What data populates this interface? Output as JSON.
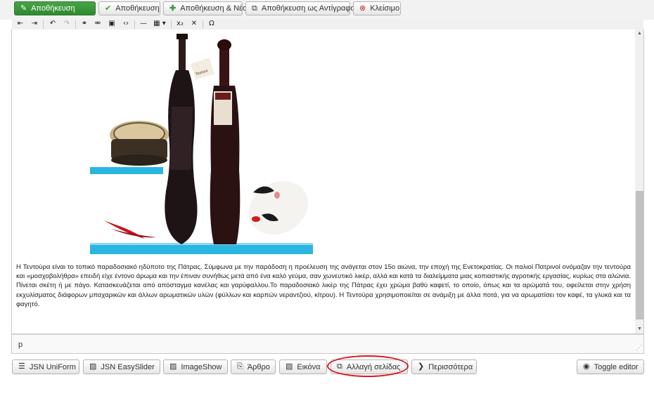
{
  "toolbar": {
    "save": "Αποθήκευση",
    "save_close": "Αποθήκευση",
    "save_new": "Αποθήκευση & Νέο",
    "save_copy": "Αποθήκευση ως Αντίγραφο",
    "close": "Κλείσιμο"
  },
  "editor": {
    "paragraph": "Η Τεντούρα είναι το τοπικό παραδοσιακό ηδύποτο της Πάτρας. Σύμφωνα με την παράδοση η προέλευση της ανάγεται στον 15ο αιώνα, την εποχή της Ενετοκρατίας. Οι παλιοί Πατρινοί ονόμαζαν την τεντούρα και «μοσχοβολήθρα» επειδή είχε έντονο άρωμα και την έπιναν συνήθως μετά από ένα καλό γεύμα, σαν χωνευτικό λικέρ, αλλά και κατά τα διαλείμματα μιας κοπιαστικής αγροτικής εργασίας, κυρίως στα αλώνια. Πίνεται σκέτη ή με πάγο. Κατασκευάζεται από απόσταγμα κανέλας και γαρύφαλλου.Το παραδοσιακό λικέρ της Πάτρας έχει χρώμα βαθύ καφετί, το οποίο, όπως και τα αρώματά του, οφείλεται στην χρήση εκχυλίσματος διάφορων μπαχαρικών και άλλων αρωματικών υλών (φύλλων και καρπών νεραντζιού, κίτρου). Η Τεντούρα χρησιμοποιείται σε ανάμιξη με άλλα ποτά, για να αρωματίσει τον καφέ, τα γλυκά και τα φαγητό.",
    "path": "p",
    "image_label_text": "Tentura"
  },
  "bottom_buttons": {
    "jsn_uniform": "JSN UniForm",
    "jsn_easyslider": "JSN EasySlider",
    "imageshow": "ImageShow",
    "article": "Άρθρο",
    "image": "Εικόνα",
    "page_break": "Αλλαγή σελίδας",
    "more": "Περισσότερα",
    "toggle_editor": "Toggle editor"
  },
  "colors": {
    "primary_green": "#3a9d3a",
    "highlight_red": "#e0141e",
    "shelf_cyan": "#29b6e0"
  },
  "icons": {
    "save": "edit-icon",
    "save_close": "check-icon",
    "save_new": "plus-icon",
    "save_copy": "copy-icon",
    "close": "cancel-circle-icon"
  }
}
